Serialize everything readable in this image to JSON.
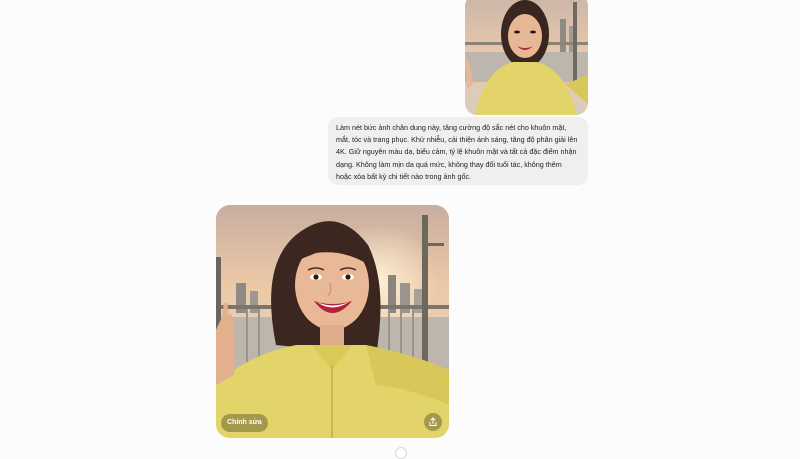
{
  "chat": {
    "user_image": {
      "alt": "selfie-photo-original"
    },
    "prompt_text": "Làm nét bức ảnh chân dung này, tăng cường độ sắc nét cho khuôn mặt, mắt, tóc và trang phục. Khử nhiễu, cải thiện ánh sáng, tăng độ phân giải lên 4K. Giữ nguyên màu da, biểu cảm, tỷ lệ khuôn mặt và tất cả đặc điểm nhận dạng. Không làm mịn da quá mức, không thay đổi tuổi tác, không thêm hoặc xóa bất kỳ chi tiết nào trong ảnh gốc.",
    "result": {
      "edit_label": "Chỉnh sửa",
      "share_icon": "share-icon"
    }
  },
  "colors": {
    "page_bg": "#fcfcfc",
    "bubble_bg": "#efeff0",
    "jacket": "#e2d468",
    "sky": "#e8c4a4"
  }
}
